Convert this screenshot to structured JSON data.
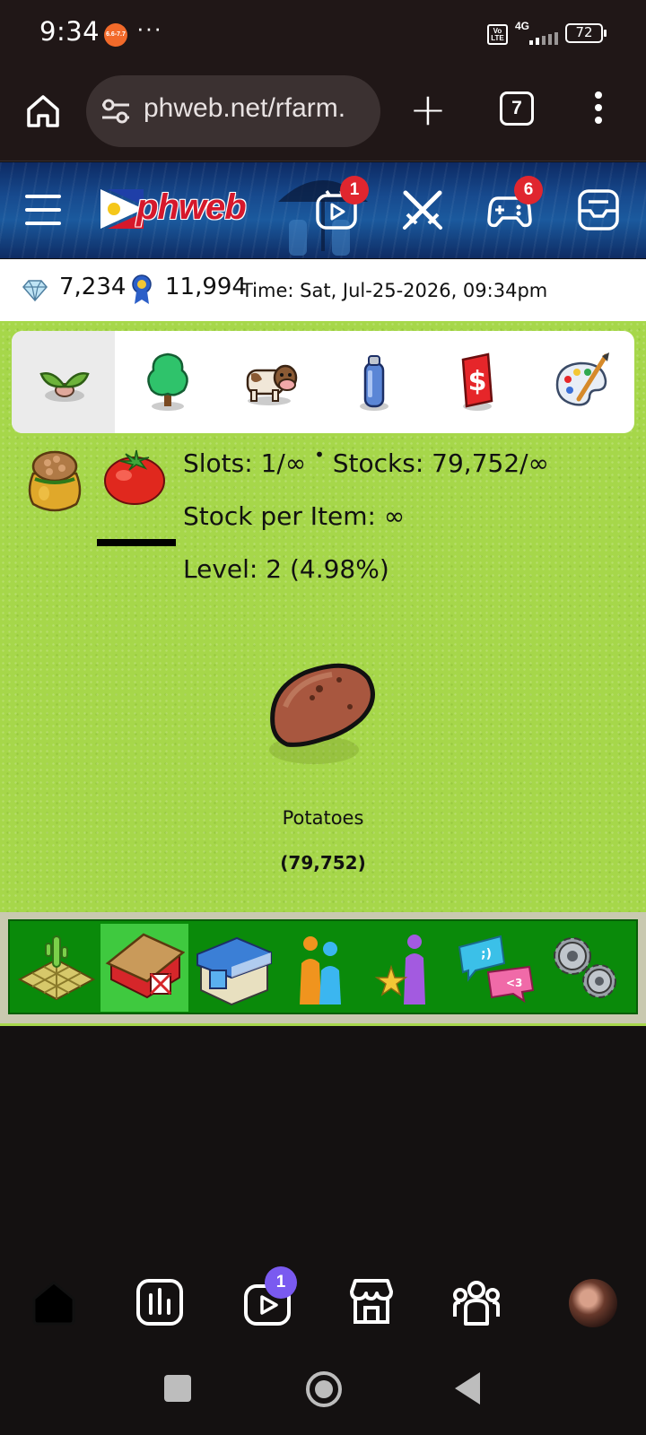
{
  "status_bar": {
    "time": "9:34",
    "notification_app": "shopee-icon",
    "notification_label": "6.6-7.7",
    "more": "···",
    "volte": "Vo LTE",
    "network": "4G",
    "battery": "72"
  },
  "browser": {
    "url": "phweb.net/rfarm.",
    "tab_count": "7"
  },
  "site_header": {
    "logo": "phweb",
    "video_badge": "1",
    "games_badge": "6"
  },
  "currency": {
    "gems": "7,234",
    "medals": "11,994",
    "time": "Time: Sat, Jul-25-2026, 09:34pm"
  },
  "categories": [
    {
      "name": "seeds-tab",
      "icon": "sprout-icon",
      "active": true
    },
    {
      "name": "trees-tab",
      "icon": "tree-icon",
      "active": false
    },
    {
      "name": "animals-tab",
      "icon": "cow-icon",
      "active": false
    },
    {
      "name": "tools-tab",
      "icon": "spray-can-icon",
      "active": false
    },
    {
      "name": "market-tab",
      "icon": "dollar-sign-icon",
      "active": false
    },
    {
      "name": "decor-tab",
      "icon": "palette-icon",
      "active": false
    }
  ],
  "storage": {
    "slots": "Slots: 1/∞",
    "separator": "•",
    "stocks": "Stocks: 79,752/∞",
    "stock_per_item": "Stock per Item: ∞",
    "level": "Level: 2 (4.98%)"
  },
  "item": {
    "name": "Potatoes",
    "quantity": "(79,752)"
  },
  "farm_nav": [
    {
      "name": "farm-land-tab",
      "icon": "farm-plot-icon",
      "active": false
    },
    {
      "name": "barn-tab",
      "icon": "barn-icon",
      "active": true
    },
    {
      "name": "shop-tab",
      "icon": "shop-icon",
      "active": false
    },
    {
      "name": "neighbors-tab",
      "icon": "people-icon",
      "active": false
    },
    {
      "name": "ranking-tab",
      "icon": "star-person-icon",
      "active": false
    },
    {
      "name": "chat-tab",
      "icon": "chat-bubbles-icon",
      "active": false
    },
    {
      "name": "settings-tab",
      "icon": "gears-icon",
      "active": false
    }
  ],
  "app_nav": {
    "video_badge": "1"
  },
  "colors": {
    "grass": "#a6d74a",
    "nav_green": "#0a8a0a",
    "nav_active": "#3fc93f",
    "badge_red": "#e0262f",
    "badge_purple": "#7a5af0"
  }
}
